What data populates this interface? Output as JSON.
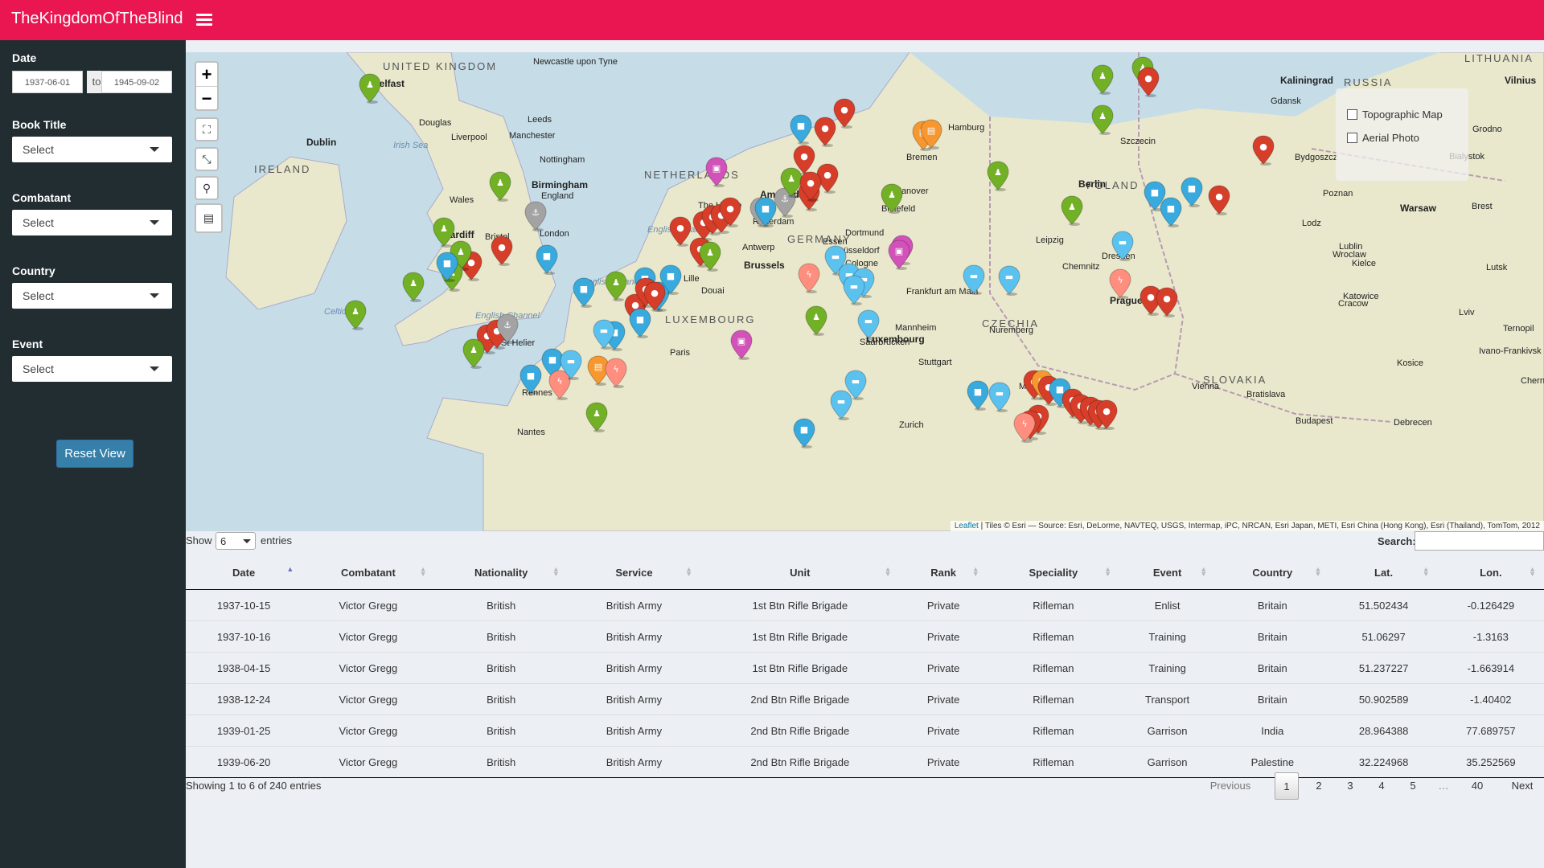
{
  "app": {
    "title": "TheKingdomOfTheBlind"
  },
  "sidebar": {
    "date_label": "Date",
    "date_from": "1937-06-01",
    "date_to_label": "to",
    "date_to": "1945-09-02",
    "filters": [
      {
        "label": "Book Title",
        "value": "Select"
      },
      {
        "label": "Combatant",
        "value": "Select"
      },
      {
        "label": "Country",
        "value": "Select"
      },
      {
        "label": "Event",
        "value": "Select"
      }
    ],
    "reset_label": "Reset View"
  },
  "map": {
    "zoom_in": "+",
    "zoom_out": "−",
    "layers": [
      "Topographic Map",
      "Aerial Photo"
    ],
    "attribution_link": "Leaflet",
    "attribution": " | Tiles © Esri — Source: Esri, DeLorme, NAVTEQ, USGS, Intermap, iPC, NRCAN, Esri Japan, METI, Esri China (Hong Kong), Esri (Thailand), TomTom, 2012",
    "labels": [
      "UNITED KINGDOM",
      "IRELAND",
      "NETHERLANDS",
      "GERMANY",
      "POLAND",
      "CZECHIA",
      "SLOVAKIA",
      "LUXEMBOURG",
      "LITHUANIA",
      "RUSSIA",
      "Belfast",
      "Dublin",
      "Newcastle upon Tyne",
      "Leeds",
      "Manchester",
      "Liverpool",
      "Birmingham",
      "Nottingham",
      "Cardiff",
      "Bristol",
      "London",
      "Douglas",
      "Irish Sea",
      "Celtic Sea",
      "English Channel",
      "English Channel",
      "English Channel",
      "Wales",
      "England",
      "The Hague",
      "Amsterdam",
      "Rotterdam",
      "Antwerp",
      "Brussels",
      "Lille",
      "Douai",
      "Essen",
      "Dortmund",
      "Düsseldorf",
      "Cologne",
      "Bielefeld",
      "Hanover",
      "Bremen",
      "Hamburg",
      "Berlin",
      "Szczecin",
      "Gdansk",
      "Kaliningrad",
      "Vilnius",
      "Grodno",
      "Bialystok",
      "Bydgoszcz",
      "Poznan",
      "Warsaw",
      "Brest",
      "Lodz",
      "Lublin",
      "Kielce",
      "Wroclaw",
      "Leipzig",
      "Dresden",
      "Chemnitz",
      "Prague",
      "Katowice",
      "Cracow",
      "Lviv",
      "Lutsk",
      "Frankfurt am Main",
      "Mannheim",
      "Nuremberg",
      "Stuttgart",
      "Saarbrucken",
      "Munich",
      "Zurich",
      "Luxembourg",
      "Paris",
      "Rennes",
      "Nantes",
      "St Helier",
      "Vienna",
      "Bratislava",
      "Budapest",
      "Debrecen",
      "Kosice",
      "Ivano-Frankivsk",
      "Ternopil",
      "Chernivtsi"
    ]
  },
  "table": {
    "show_label": "Show",
    "page_size": "6",
    "entries_label": "entries",
    "search_label": "Search:",
    "columns": [
      "Date",
      "Combatant",
      "Nationality",
      "Service",
      "Unit",
      "Rank",
      "Speciality",
      "Event",
      "Country",
      "Lat.",
      "Lon."
    ],
    "rows": [
      [
        "1937-10-15",
        "Victor Gregg",
        "British",
        "British Army",
        "1st Btn Rifle Brigade",
        "Private",
        "Rifleman",
        "Enlist",
        "Britain",
        "51.502434",
        "-0.126429"
      ],
      [
        "1937-10-16",
        "Victor Gregg",
        "British",
        "British Army",
        "1st Btn Rifle Brigade",
        "Private",
        "Rifleman",
        "Training",
        "Britain",
        "51.06297",
        "-1.3163"
      ],
      [
        "1938-04-15",
        "Victor Gregg",
        "British",
        "British Army",
        "1st Btn Rifle Brigade",
        "Private",
        "Rifleman",
        "Training",
        "Britain",
        "51.237227",
        "-1.663914"
      ],
      [
        "1938-12-24",
        "Victor Gregg",
        "British",
        "British Army",
        "2nd Btn Rifle Brigade",
        "Private",
        "Rifleman",
        "Transport",
        "Britain",
        "50.902589",
        "-1.40402"
      ],
      [
        "1939-01-25",
        "Victor Gregg",
        "British",
        "British Army",
        "2nd Btn Rifle Brigade",
        "Private",
        "Rifleman",
        "Garrison",
        "India",
        "28.964388",
        "77.689757"
      ],
      [
        "1939-06-20",
        "Victor Gregg",
        "British",
        "British Army",
        "2nd Btn Rifle Brigade",
        "Private",
        "Rifleman",
        "Garrison",
        "Palestine",
        "32.224968",
        "35.252569"
      ]
    ],
    "info": "Showing 1 to 6 of 240 entries",
    "pagination": [
      "Previous",
      "1",
      "2",
      "3",
      "4",
      "5",
      "…",
      "40",
      "Next"
    ],
    "current_page": "1"
  },
  "colors": {
    "topbar": "#e91651",
    "sidebar": "#222d32",
    "button": "#367fa9",
    "marker_red": "#d63e2a",
    "marker_green": "#72b026",
    "marker_blue": "#38aadd",
    "marker_lightblue": "#5bc2f0",
    "marker_purple": "#d252b9",
    "marker_orange": "#f69730",
    "marker_pink": "#ff8e7f",
    "marker_gray": "#a3a3a3"
  }
}
